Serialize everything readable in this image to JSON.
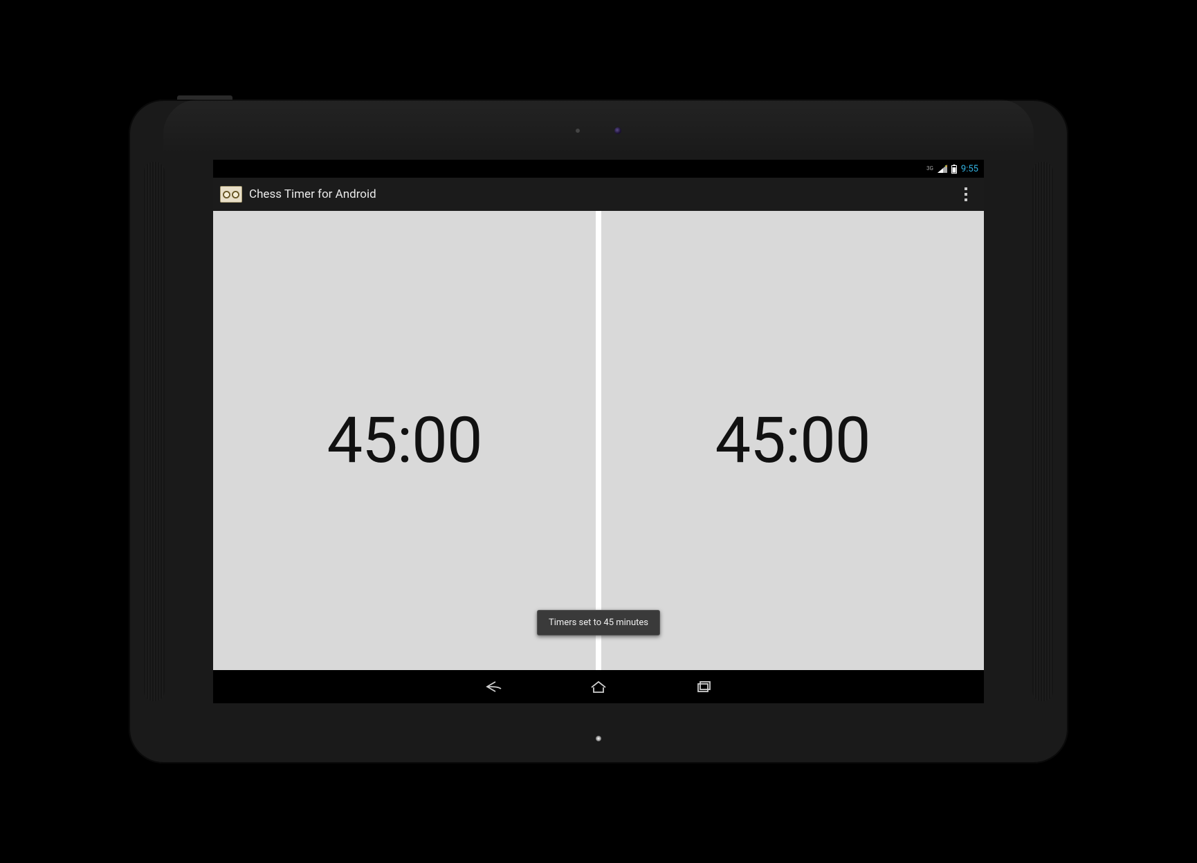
{
  "statusbar": {
    "network_label": "3G",
    "clock": "9:55"
  },
  "actionbar": {
    "title": "Chess Timer for Android"
  },
  "timers": {
    "left": "45:00",
    "right": "45:00"
  },
  "toast": {
    "message": "Timers set to 45 minutes"
  }
}
